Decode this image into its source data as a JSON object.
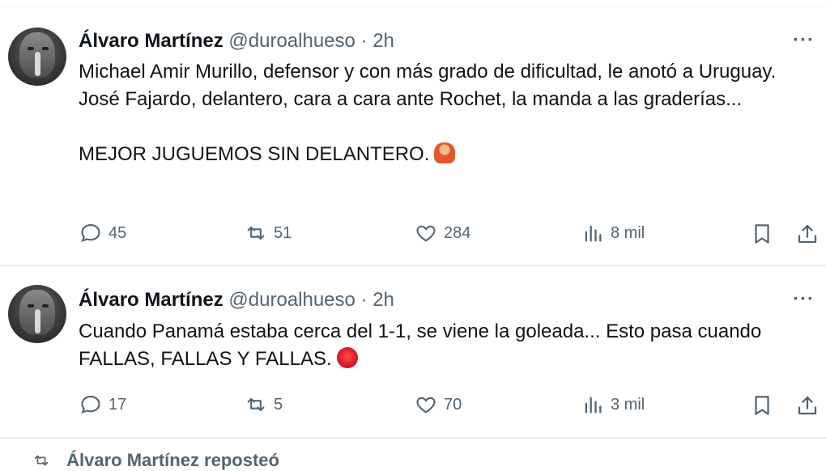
{
  "tweets": [
    {
      "name": "Álvaro Martínez",
      "handle": "@duroalhueso",
      "separator": "·",
      "time": "2h",
      "more": "···",
      "paragraphs": [
        "Michael Amir Murillo, defensor y con más grado de dificultad, le anotó a Uruguay. José Fajardo, delantero, cara a cara ante Rochet, la manda a las graderías...",
        "MEJOR JUGUEMOS SIN DELANTERO."
      ],
      "emoji": "person-emoji-icon",
      "replies": "45",
      "reposts": "51",
      "likes": "284",
      "views": "8 mil"
    },
    {
      "name": "Álvaro Martínez",
      "handle": "@duroalhueso",
      "separator": "·",
      "time": "2h",
      "more": "···",
      "paragraphs": [
        "Cuando Panamá estaba cerca del 1-1, se viene la goleada... Esto pasa cuando FALLAS, FALLAS Y FALLAS."
      ],
      "emoji": "angry-face-emoji-icon",
      "replies": "17",
      "reposts": "5",
      "likes": "70",
      "views": "3 mil"
    }
  ],
  "footer": {
    "repost_label": "Álvaro Martínez reposteó"
  },
  "colors": {
    "text": "#0f1419",
    "muted": "#536471",
    "divider": "#e7eaec"
  }
}
